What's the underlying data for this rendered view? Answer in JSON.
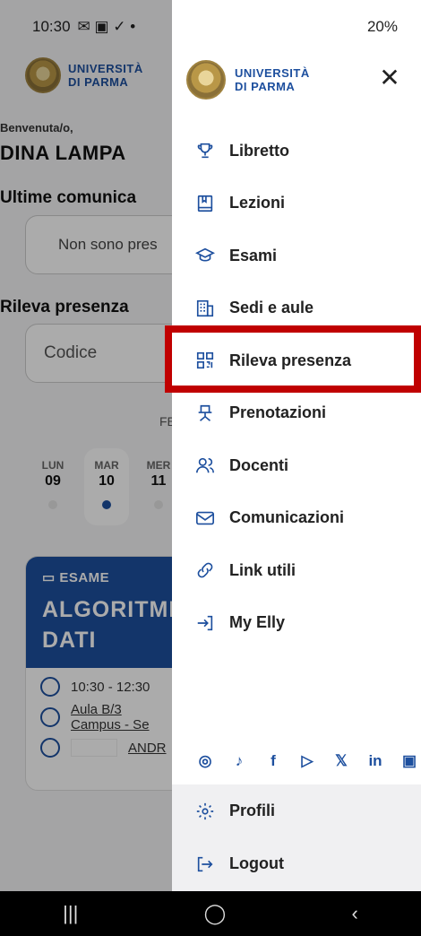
{
  "status_bar": {
    "time": "10:30",
    "left_icons": "✉ ▣ ✓ •",
    "right_text": "20%"
  },
  "background": {
    "logo_line1": "UNIVERSITÀ",
    "logo_line2": "DI PARMA",
    "welcome": "Benvenuta/o,",
    "username": "DINA LAMPA",
    "comms_title": "Ultime comunica",
    "comms_empty": "Non sono pres",
    "attendance_title": "Rileva presenza",
    "code_placeholder": "Codice",
    "month": "FE",
    "days": [
      {
        "name": "LUN",
        "num": "09"
      },
      {
        "name": "MAR",
        "num": "10"
      },
      {
        "name": "MER",
        "num": "11"
      }
    ],
    "event": {
      "type": "ESAME",
      "title_line1": "ALGORITMI",
      "title_line2": "DATI",
      "time": "10:30 - 12:30",
      "room": "Aula B/3",
      "campus": "Campus - Se",
      "teacher": "ANDR"
    }
  },
  "drawer": {
    "logo_line1": "UNIVERSITÀ",
    "logo_line2": "DI PARMA",
    "close_label": "✕",
    "items": [
      {
        "label": "Libretto",
        "icon": "trophy-icon"
      },
      {
        "label": "Lezioni",
        "icon": "book-icon"
      },
      {
        "label": "Esami",
        "icon": "graduation-cap-icon"
      },
      {
        "label": "Sedi e aule",
        "icon": "building-icon"
      },
      {
        "label": "Rileva presenza",
        "icon": "qr-code-icon"
      },
      {
        "label": "Prenotazioni",
        "icon": "chair-icon"
      },
      {
        "label": "Docenti",
        "icon": "people-icon"
      },
      {
        "label": "Comunicazioni",
        "icon": "mail-icon"
      },
      {
        "label": "Link utili",
        "icon": "link-icon"
      },
      {
        "label": "My Elly",
        "icon": "login-arrow-icon"
      }
    ],
    "socials": [
      "instagram-icon",
      "tiktok-icon",
      "facebook-icon",
      "youtube-icon",
      "x-icon",
      "linkedin-icon",
      "flickr-icon"
    ],
    "footer": [
      {
        "label": "Profili",
        "icon": "gear-icon"
      },
      {
        "label": "Logout",
        "icon": "logout-icon"
      }
    ]
  },
  "navbar": {
    "recent": "|||",
    "home": "◯",
    "back": "‹"
  },
  "colors": {
    "brand": "#1d4f9e",
    "highlight": "#c00000"
  }
}
